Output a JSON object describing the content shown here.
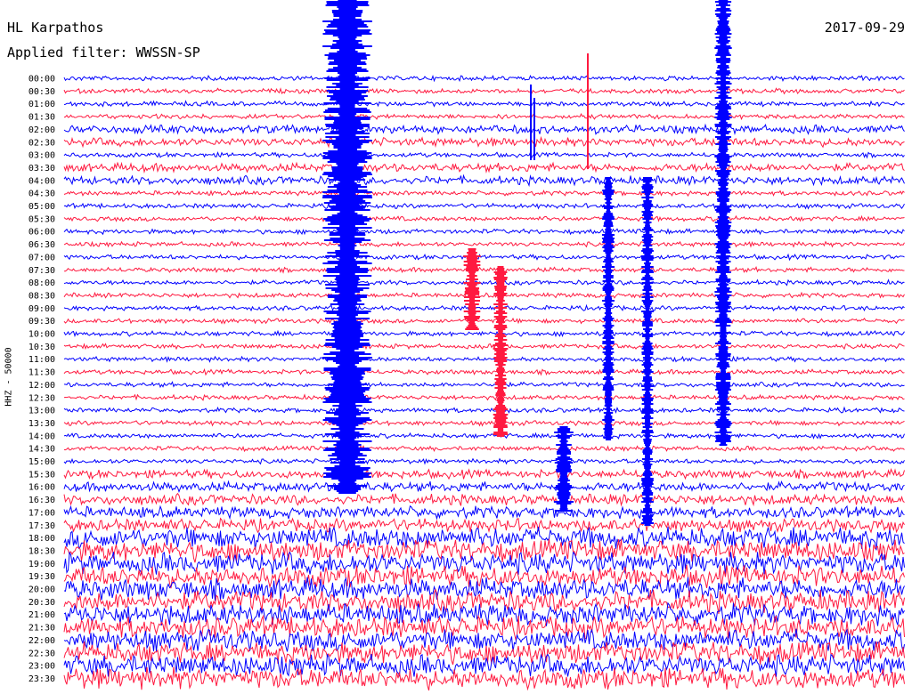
{
  "header": {
    "station": "HL Karpathos",
    "filter": "Applied filter: WWSSN-SP",
    "date": "2017-09-29"
  },
  "chart_data": {
    "type": "line",
    "title": "HL Karpathos",
    "subtitle": "Applied filter: WWSSN-SP",
    "ylabel": "HHZ - 50000",
    "xlabel": "",
    "rows": [
      "00:00",
      "00:30",
      "01:00",
      "01:30",
      "02:00",
      "02:30",
      "03:00",
      "03:30",
      "04:00",
      "04:30",
      "05:00",
      "05:30",
      "06:00",
      "06:30",
      "07:00",
      "07:30",
      "08:00",
      "08:30",
      "09:00",
      "09:30",
      "10:00",
      "10:30",
      "11:00",
      "11:30",
      "12:00",
      "12:30",
      "13:00",
      "13:30",
      "14:00",
      "14:30",
      "15:00",
      "15:30",
      "16:00",
      "16:30",
      "17:00",
      "17:30",
      "18:00",
      "18:30",
      "19:00",
      "19:30",
      "20:00",
      "20:30",
      "21:00",
      "21:30",
      "22:00",
      "22:30",
      "23:00",
      "23:30"
    ],
    "series_colors": [
      "#0000ff",
      "#ff1a40"
    ],
    "color_pattern": "alternating blue / red traces",
    "grid": false,
    "legend": "none"
  }
}
